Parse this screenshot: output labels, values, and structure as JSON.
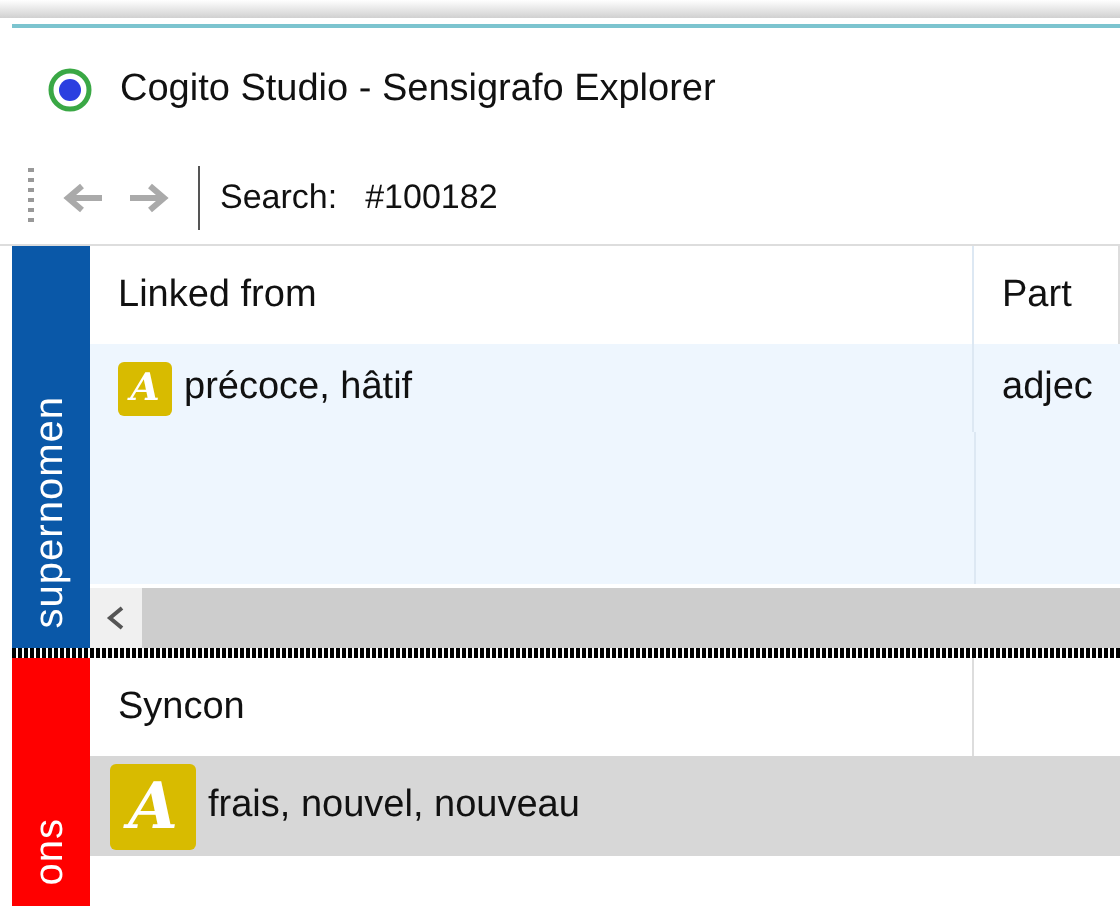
{
  "window": {
    "title": "Cogito Studio - Sensigrafo Explorer"
  },
  "toolbar": {
    "search_label": "Search:",
    "search_value": "#100182"
  },
  "panels": [
    {
      "tab": {
        "label": "supernomen",
        "color": "#0a58a8"
      },
      "columns": [
        "Linked from",
        "Part"
      ],
      "rows": [
        {
          "badge": "A",
          "cells": [
            "précoce, hâtif",
            "adjec"
          ],
          "selected": false
        }
      ],
      "scrollbar": true
    },
    {
      "tab": {
        "label": "ons",
        "color": "#ff0000"
      },
      "columns": [
        "Syncon"
      ],
      "rows": [
        {
          "badge": "A",
          "cells": [
            "frais, nouvel, nouveau"
          ],
          "selected": true
        }
      ],
      "scrollbar": false
    }
  ]
}
